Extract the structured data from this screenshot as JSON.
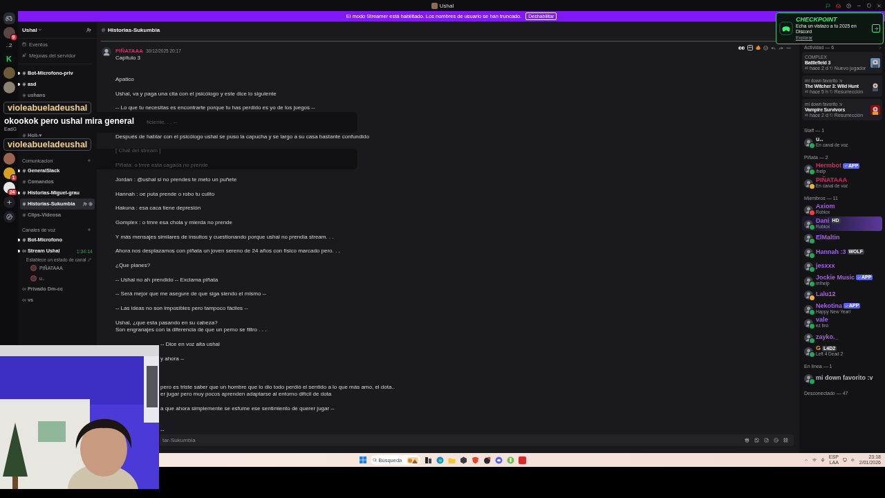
{
  "titlebar": {
    "title": "Ushal"
  },
  "banner": {
    "text": "El modo Streamer está habilitado. Los nombres de usuario se han truncado.",
    "button": "Deshabilitar"
  },
  "checkpoint": {
    "title": "CHECKPOINT",
    "text": "Echa un vistazo a tu 2025 en Discord",
    "link": "Explorar"
  },
  "rail": [
    {
      "kind": "home"
    },
    {
      "kind": "avatar",
      "color": "#5a4444",
      "badge": "9"
    },
    {
      "kind": "label",
      "text": "..2"
    },
    {
      "kind": "letter",
      "text": "K",
      "color": "#1ed760"
    },
    {
      "kind": "avatar",
      "color": "#6d5a38"
    },
    {
      "kind": "avatar",
      "color": "#8c8272"
    },
    {
      "kind": "avatar-after-overlay",
      "color": "#9a6450"
    },
    {
      "kind": "avatar",
      "color": "#d8a11e",
      "badge": "1"
    },
    {
      "kind": "avatar",
      "color": "#e6e6e6",
      "badge": "24"
    },
    {
      "kind": "add"
    },
    {
      "kind": "discover"
    }
  ],
  "sidebar": {
    "server": "Ushal",
    "nav": [
      {
        "kind": "events",
        "label": "Eventos"
      },
      {
        "kind": "boosts",
        "label": "Mejoras del servidor"
      }
    ],
    "channels": [
      {
        "kind": "channel",
        "name": "Bot-Microfono-priv",
        "unread": true,
        "selected": false
      },
      {
        "kind": "channel",
        "name": "asd",
        "unread": true,
        "selected": false
      },
      {
        "kind": "channel",
        "name": "ushans",
        "unread": false,
        "selected": false
      },
      {
        "kind": "peek-channel",
        "name": "Holi-♥",
        "unread": false,
        "selected": false
      },
      {
        "kind": "peek-category",
        "name": "Comunicacion"
      },
      {
        "kind": "channel",
        "name": "GeneralSlack",
        "unread": true,
        "selected": false
      },
      {
        "kind": "channel",
        "name": "Comandos",
        "unread": false,
        "selected": false
      },
      {
        "kind": "channel",
        "name": "Historias-Miguel-grau",
        "unread": true,
        "selected": false
      },
      {
        "kind": "channel",
        "name": "Historias-Sukumbia",
        "unread": false,
        "selected": true
      },
      {
        "kind": "channel",
        "name": "Clips-Videosa",
        "unread": false,
        "selected": false
      },
      {
        "kind": "category",
        "name": "Canales de voz"
      },
      {
        "kind": "channel",
        "name": "Bot-Microfono",
        "unread": true,
        "selected": false
      },
      {
        "kind": "voice",
        "name": "Stream Ushal",
        "timer": "1:34:14",
        "unread": true,
        "selected": false
      },
      {
        "kind": "voice-status",
        "name": "Establece un estado de canal"
      },
      {
        "kind": "voice-user",
        "name": "PIÑATAAA"
      },
      {
        "kind": "voice-user",
        "name": "u.."
      },
      {
        "kind": "voice",
        "name": "Privado Dm-cc",
        "unread": false,
        "selected": false
      },
      {
        "kind": "voice",
        "name": "vs",
        "unread": false,
        "selected": false
      }
    ]
  },
  "overlay_chat": [
    {
      "user": "violeabueladeushal",
      "text": "okookok pero ushal mira general",
      "sub": "EadG"
    },
    {
      "user": "violeabueladeushal"
    }
  ],
  "chat": {
    "channel": "Historias-Sukumbia",
    "message": {
      "author": "PIÑATAAA",
      "time": "30/12/2025 20:17",
      "lead": "Capitulo 3",
      "lines": [
        {
          "kind": "text",
          "text": "Apatico"
        },
        {
          "kind": "text",
          "text": "Ushal, va y paga una cita con el psicólogo y este dice lo siguiente"
        },
        {
          "kind": "text",
          "text": "-- Lo que tu necesitas es encontrarte porque tu has perdido es yo de los juegos --"
        },
        {
          "kind": "behind-overlay",
          "text": "ficiente. . . --"
        },
        {
          "kind": "text",
          "text": "Después de hablar con el psicólogo ushal se puso la capucha y se largo a su casa bastante confundido"
        },
        {
          "kind": "dim",
          "text": "[ Chat del stream ]"
        },
        {
          "kind": "dim",
          "text": "Piñata: o tmre esta cagada no prende"
        },
        {
          "kind": "text",
          "text": "Jordan : @ushal si no prendes te meto un puñete"
        },
        {
          "kind": "text",
          "text": "Hannah : oe puta prende o robo tu culito"
        },
        {
          "kind": "text",
          "text": "Hakuna : esa caca tiene depresión"
        },
        {
          "kind": "text",
          "text": "Gomplex : o tmre esa chola y mierda no prende"
        },
        {
          "kind": "text",
          "text": "Y más mensajes similares de insultos y cuestionando porque ushal no prendia stream. . ."
        },
        {
          "kind": "text",
          "text": "Ahora nos desplazamos con piñata un joven sereno de 24 años con físico marcado pero. . ."
        },
        {
          "kind": "text",
          "text": "¿Que planes?"
        },
        {
          "kind": "text",
          "text": "-- Ushal no ah prendido -- Exclama piñata"
        },
        {
          "kind": "text",
          "text": "-- Será mejor que me asegure de que siga siendo el mismo --"
        },
        {
          "kind": "text",
          "text": "-- Las ideas no son imposibles pero tampoco fáciles --"
        },
        {
          "kind": "text",
          "text": "Ushal, ¿que esta pasando en su cabeza?\nSon engranajes con la diferencia de que un perno se filtro . . ."
        },
        {
          "kind": "behind-camera",
          "text": "-- Dice en voz alta ushal"
        },
        {
          "kind": "behind-camera",
          "text": "y ahora --"
        },
        {
          "kind": "after-hidden",
          "text": "pero es triste saber que un hombre que lo dio todo perdió el sentido a lo que más amo, el dota..\ner jugar pero muy pocos aprenden adaptarse al entorno difícil de dota"
        },
        {
          "kind": "behind-camera",
          "text": "a que ahora simplemente se esfume ese sentimiento de querer jugar --"
        },
        {
          "kind": "second-line",
          "text": "--"
        }
      ]
    },
    "composer": {
      "placeholder": "tar-Sukumbia"
    }
  },
  "members": {
    "activity": {
      "title": "Actividad — 6",
      "cards": [
        {
          "user": "COMPLEX",
          "game": "Battlefield 3",
          "when": "hace 2 d",
          "note": "Nuevo jugador"
        },
        {
          "user": "mi down favorito :v",
          "game": "The Witcher 3: Wild Hunt",
          "when": "hace 5 h",
          "note": "Resurrección"
        },
        {
          "user": "mi down favorito :v",
          "game": "Vampire Survivors",
          "when": "hace 2 d",
          "note": "Resurrección"
        }
      ]
    },
    "sections": [
      {
        "title": "Staff — 1",
        "members": [
          {
            "name": "u..",
            "sub": "En canal de voz",
            "status": {
              "color": "#23a55a"
            },
            "nameplate": false
          }
        ]
      },
      {
        "title": "Piñata — 2",
        "members": [
          {
            "name": "Hermbot",
            "color": "#e0245e",
            "tag": {
              "text": "APP",
              "kind": "bot"
            },
            "sub": "/help",
            "status": {
              "color": "#23a55a"
            },
            "nameplate": false
          },
          {
            "name": "PIÑATAAA",
            "color": "#e0245e",
            "sub": "En canal de voz",
            "status": {
              "color": "#f0b232"
            },
            "nameplate": false
          }
        ]
      },
      {
        "title": "Miembros — 11",
        "members": [
          {
            "name": "Axiom",
            "color": "#a65fe3",
            "sub": "Roblox",
            "status": {
              "color": "#f23f43"
            },
            "nameplate": false
          },
          {
            "name": "Dani",
            "color": "#a65fe3",
            "tag": {
              "text": "HD",
              "kind": "guild"
            },
            "sub": "Roblox",
            "status": {
              "color": "#23a55a"
            },
            "nameplate": true
          },
          {
            "name": "ElMaltin",
            "color": "#a65fe3",
            "status": {
              "color": "#23a55a"
            },
            "nameplate": false
          },
          {
            "name": "Hannah :3",
            "color": "#a65fe3",
            "tag": {
              "text": "WOLF",
              "kind": "guild"
            },
            "status": {
              "color": "#23a55a"
            },
            "nameplate": false
          },
          {
            "name": "jesxxx",
            "color": "#a65fe3",
            "status": {
              "color": "#23a55a"
            },
            "nameplate": false
          },
          {
            "name": "Jockie Music",
            "color": "#a65fe3",
            "tag": {
              "text": "APP",
              "kind": "bot"
            },
            "sub": "m!help",
            "status": {
              "color": "#23a55a"
            },
            "nameplate": false
          },
          {
            "name": "Lalu12",
            "color": "#a65fe3",
            "status": {
              "color": "#f0b232"
            },
            "nameplate": false
          },
          {
            "name": "Nekotina",
            "color": "#a65fe3",
            "tag": {
              "text": "APP",
              "kind": "bot"
            },
            "sub": "Happy New Year!",
            "status": {
              "color": "#23a55a"
            },
            "nameplate": false
          },
          {
            "name": "vale",
            "color": "#a65fe3",
            "sub": "ez bro",
            "status": {
              "color": "#23a55a"
            },
            "nameplate": false
          },
          {
            "name": "zayko._",
            "color": "#a65fe3",
            "status": {
              "color": "#23a55a"
            },
            "nameplate": false
          },
          {
            "name": "G",
            "color": "#f0a030",
            "tag": {
              "text": "L4D2",
              "kind": "guild"
            },
            "sub": "Left 4 Dead 2",
            "status": {
              "color": "#23a55a"
            },
            "nameplate": false
          }
        ]
      },
      {
        "title": "En línea — 1",
        "members": [
          {
            "name": "mi down favorito :v",
            "color": "#b5bac1",
            "status": {
              "color": "#23a55a"
            },
            "nameplate": false
          }
        ]
      },
      {
        "title": "Desconectado — 47"
      }
    ]
  },
  "taskbar": {
    "search": "Búsqueda",
    "apps": [
      {
        "kind": "explorer"
      },
      {
        "kind": "browser"
      },
      {
        "kind": "folder"
      },
      {
        "kind": "launcher"
      },
      {
        "kind": "shield"
      },
      {
        "kind": "dark"
      },
      {
        "kind": "chat"
      },
      {
        "kind": "torrent"
      },
      {
        "kind": "red"
      }
    ],
    "lang": "ESP",
    "layout": "LAA",
    "time": "23:18",
    "date": "2/01/2026"
  }
}
